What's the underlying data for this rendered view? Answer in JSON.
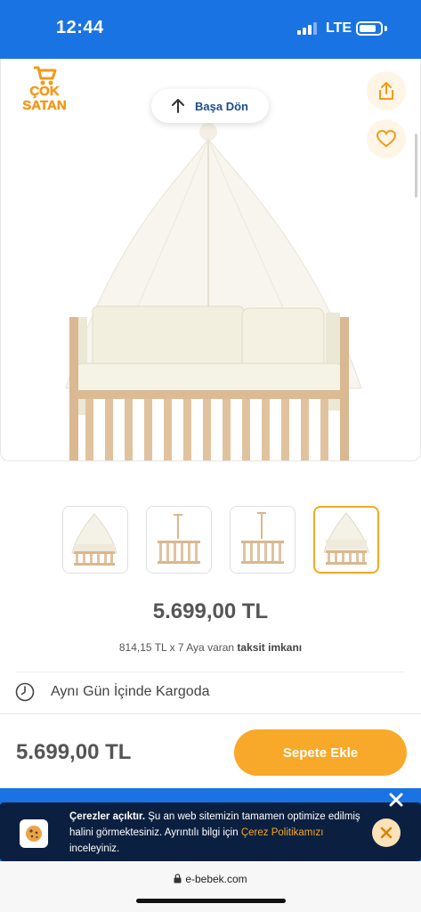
{
  "status_bar": {
    "time": "12:44",
    "network": "LTE"
  },
  "badge": {
    "line1": "ÇOK",
    "line2": "SATAN"
  },
  "back_button": {
    "label": "Başa Dön"
  },
  "icons": {
    "share": "share-icon",
    "favorite": "heart-icon",
    "clock": "clock-icon",
    "cookie": "cookie-icon",
    "close": "close-icon",
    "lock": "lock-icon"
  },
  "colors": {
    "brand_blue": "#1a73e2",
    "accent_orange": "#f8a929",
    "link_orange": "#f5a623"
  },
  "thumbnails": {
    "count": 4,
    "active_index": 3
  },
  "product": {
    "price": "5.699,00 TL",
    "installment_prefix": "814,15 TL x 7 Aya varan ",
    "installment_bold": "taksit imkanı"
  },
  "shipping": {
    "label": "Aynı Gün İçinde Kargoda"
  },
  "bottom_bar": {
    "price": "5.699,00 TL",
    "cart_button": "Sepete Ekle"
  },
  "cookie": {
    "title": "Çerezler açıktır.",
    "text": " Şu an web sitemizin tamamen optimize edilmiş halini görmektesiniz. Ayrıntılı bilgi için ",
    "link": "Çerez Politikamızı",
    "suffix": " inceleyiniz."
  },
  "browser": {
    "url": "e-bebek.com"
  }
}
